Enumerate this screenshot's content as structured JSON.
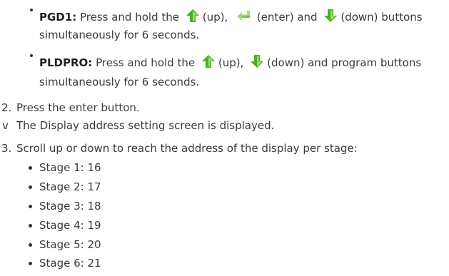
{
  "colors": {
    "arrow_green_light": "#a6d96a",
    "arrow_green_dark": "#4caf1f",
    "text": "#3a3a3a"
  },
  "pgd1": {
    "label": "PGD1:",
    "text_1": "Press and hold the",
    "up_label": "(up),",
    "enter_label": "(enter) and",
    "down_label": "(down) buttons",
    "text_2": "simultaneously for 6 seconds.",
    "icons": [
      "up-arrow-icon",
      "enter-arrow-icon",
      "down-arrow-icon"
    ]
  },
  "pldpro": {
    "label": "PLDPRO:",
    "text_1": "Press and hold the",
    "up_label": "(up),",
    "down_label": "(down) and program buttons",
    "text_2": "simultaneously for 6 seconds.",
    "icons": [
      "up-arrow-icon",
      "down-arrow-icon"
    ]
  },
  "step2": {
    "num": "2.",
    "text": "Press the enter button."
  },
  "result": {
    "marker": "v",
    "text": "The Display address setting screen is displayed."
  },
  "step3": {
    "num": "3.",
    "text": "Scroll up or down to reach the address of the display per stage:"
  },
  "stages": [
    "Stage 1: 16",
    "Stage 2: 17",
    "Stage 3: 18",
    "Stage 4: 19",
    "Stage 5: 20",
    "Stage 6: 21"
  ]
}
